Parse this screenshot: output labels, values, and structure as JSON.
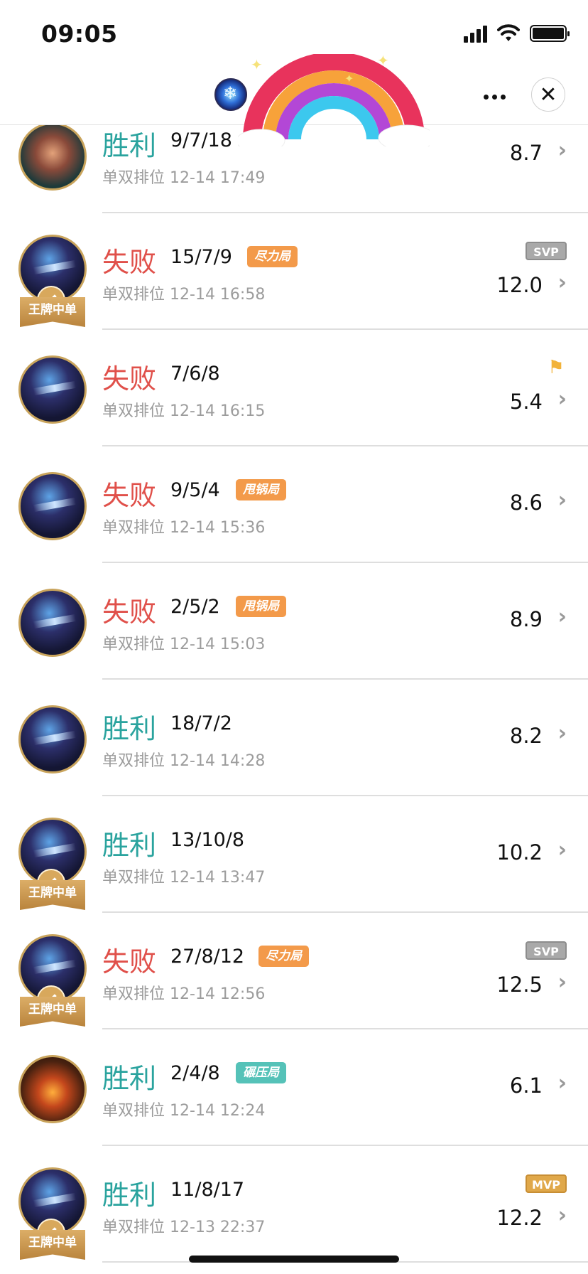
{
  "status_bar": {
    "time": "09:05"
  },
  "nav": {
    "more_label": "•••",
    "close_label": "✕"
  },
  "matches": [
    {
      "result": "胜利",
      "outcome": "win",
      "kda": "9/7/18",
      "tag": "",
      "mode": "单双排位",
      "datetime": "12-14 17:49",
      "score": "8.7",
      "badge": "",
      "hero": "green",
      "ace": false
    },
    {
      "result": "失败",
      "outcome": "loss",
      "kda": "15/7/9",
      "tag": "尽力局",
      "mode": "单双排位",
      "datetime": "12-14 16:58",
      "score": "12.0",
      "badge": "SVP",
      "hero": "dark",
      "ace": true,
      "ace_label": "王牌中单"
    },
    {
      "result": "失败",
      "outcome": "loss",
      "kda": "7/6/8",
      "tag": "",
      "mode": "单双排位",
      "datetime": "12-14 16:15",
      "score": "5.4",
      "badge": "icon",
      "hero": "dark",
      "ace": false
    },
    {
      "result": "失败",
      "outcome": "loss",
      "kda": "9/5/4",
      "tag": "甩锅局",
      "mode": "单双排位",
      "datetime": "12-14 15:36",
      "score": "8.6",
      "badge": "",
      "hero": "dark",
      "ace": false
    },
    {
      "result": "失败",
      "outcome": "loss",
      "kda": "2/5/2",
      "tag": "甩锅局",
      "mode": "单双排位",
      "datetime": "12-14 15:03",
      "score": "8.9",
      "badge": "",
      "hero": "dark",
      "ace": false
    },
    {
      "result": "胜利",
      "outcome": "win",
      "kda": "18/7/2",
      "tag": "",
      "mode": "单双排位",
      "datetime": "12-14 14:28",
      "score": "8.2",
      "badge": "",
      "hero": "dark",
      "ace": false
    },
    {
      "result": "胜利",
      "outcome": "win",
      "kda": "13/10/8",
      "tag": "",
      "mode": "单双排位",
      "datetime": "12-14 13:47",
      "score": "10.2",
      "badge": "",
      "hero": "dark",
      "ace": true,
      "ace_label": "王牌中单"
    },
    {
      "result": "失败",
      "outcome": "loss",
      "kda": "27/8/12",
      "tag": "尽力局",
      "mode": "单双排位",
      "datetime": "12-14 12:56",
      "score": "12.5",
      "badge": "SVP",
      "hero": "dark",
      "ace": true,
      "ace_label": "王牌中单"
    },
    {
      "result": "胜利",
      "outcome": "win",
      "kda": "2/4/8",
      "tag": "碾压局",
      "mode": "单双排位",
      "datetime": "12-14 12:24",
      "score": "6.1",
      "badge": "",
      "hero": "fire",
      "ace": false
    },
    {
      "result": "胜利",
      "outcome": "win",
      "kda": "11/8/17",
      "tag": "",
      "mode": "单双排位",
      "datetime": "12-13 22:37",
      "score": "12.2",
      "badge": "MVP",
      "hero": "dark",
      "ace": true,
      "ace_label": "王牌中单"
    }
  ],
  "chevron": "›"
}
